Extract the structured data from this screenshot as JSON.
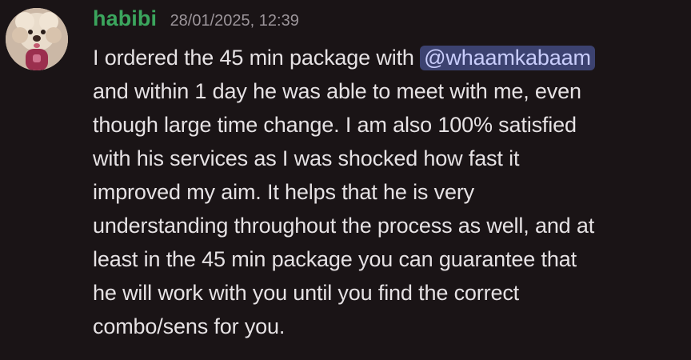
{
  "message": {
    "author": "habibi",
    "timestamp": "28/01/2025, 12:39",
    "avatar_icon": "dog-avatar",
    "colors": {
      "username": "#3ba55d",
      "mention_bg": "#3c4270",
      "mention_text": "#c9cdfb",
      "background": "#1a1416"
    },
    "content": {
      "line1_prefix": "I ordered the 45 min package with ",
      "mention": "@whaamkabaam",
      "lines": [
        "and within 1 day he was able to meet with me, even",
        "though large time change. I am also 100% satisfied",
        "with his services as I was shocked how fast it",
        "improved my aim. It helps that he is very",
        "understanding throughout the process as well, and at",
        "least in the 45 min package you can guarantee that",
        "he will work with you until you find the correct",
        "combo/sens for you."
      ]
    }
  }
}
